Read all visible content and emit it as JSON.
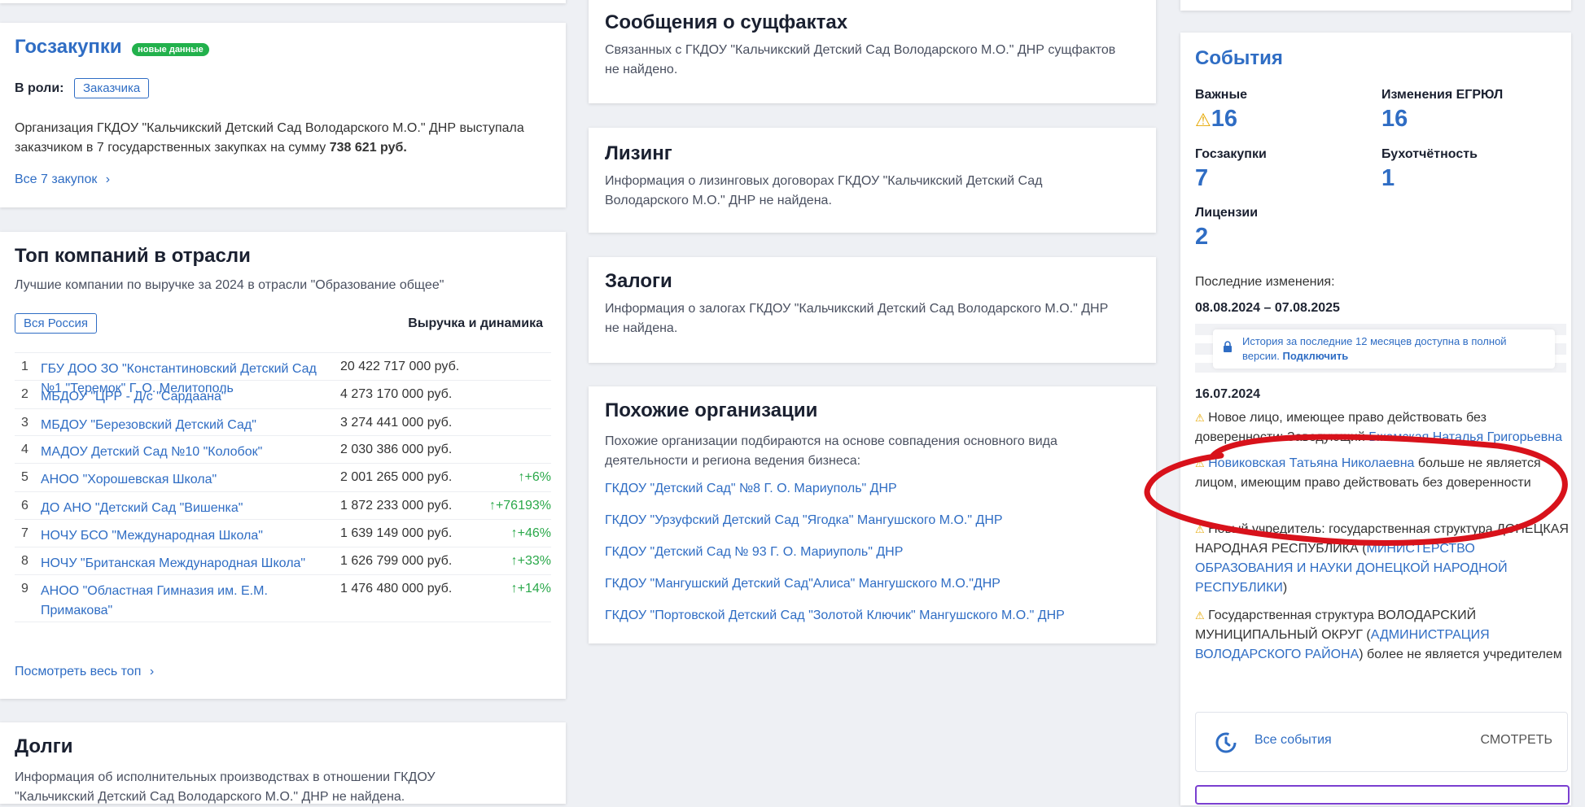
{
  "goszakupki": {
    "title": "Госзакупки",
    "badge": "новые данные",
    "role_label": "В роли:",
    "role_value": "Заказчика",
    "text": "Организация ГКДОУ \"Кальчикский Детский Сад Володарского М.О.\" ДНР выступала заказчиком в 7 государственных закупках на сумму",
    "amount": "738 621 руб.",
    "all_link": "Все 7 закупок"
  },
  "top": {
    "title": "Топ компаний в отрасли",
    "subtitle": "Лучшие компании по выручке за 2024 в отрасли \"Образование общее\"",
    "region_chip": "Вся Россия",
    "revenue_header": "Выручка и динамика",
    "rows": [
      {
        "n": "1",
        "name": "ГБУ ДОО ЗО \"Константиновский Детский Сад №1 \"Теремок\" Г. О. Мелитополь",
        "revenue": "20 422 717 000 руб.",
        "dyn": ""
      },
      {
        "n": "2",
        "name": "МБДОУ \"ЦРР - Д/с \"Сардаана\"",
        "revenue": "4 273 170 000 руб.",
        "dyn": ""
      },
      {
        "n": "3",
        "name": "МБДОУ \"Березовский Детский Сад\"",
        "revenue": "3 274 441 000 руб.",
        "dyn": ""
      },
      {
        "n": "4",
        "name": "МАДОУ Детский Сад №10 \"Колобок\"",
        "revenue": "2 030 386 000 руб.",
        "dyn": ""
      },
      {
        "n": "5",
        "name": "АНОО \"Хорошевская Школа\"",
        "revenue": "2 001 265 000 руб.",
        "dyn": "↑+6%"
      },
      {
        "n": "6",
        "name": "ДО АНО \"Детский Сад \"Вишенка\"",
        "revenue": "1 872 233 000 руб.",
        "dyn": "↑+76193%"
      },
      {
        "n": "7",
        "name": "НОЧУ БСО \"Международная Школа\"",
        "revenue": "1 639 149 000 руб.",
        "dyn": "↑+46%"
      },
      {
        "n": "8",
        "name": "НОЧУ \"Британская Международная Школа\"",
        "revenue": "1 626 799 000 руб.",
        "dyn": "↑+33%"
      },
      {
        "n": "9",
        "name": "АНОО \"Областная Гимназия им. Е.М. Примакова\"",
        "revenue": "1 476 480 000 руб.",
        "dyn": "↑+14%"
      }
    ],
    "all_link": "Посмотреть весь топ"
  },
  "dolgi": {
    "title": "Долги",
    "text": "Информация об исполнительных производствах в отношении ГКДОУ",
    "text2": "\"Кальчикский Детский Сад Володарского М.О.\" ДНР не найдена."
  },
  "sushfakty": {
    "title": "Сообщения о сущфактах",
    "text": "Связанных с ГКДОУ \"Кальчикский Детский Сад Володарского М.О.\" ДНР сущфактов не найдено."
  },
  "lizing": {
    "title": "Лизинг",
    "text": "Информация о лизинговых договорах ГКДОУ \"Кальчикский Детский Сад Володарского М.О.\" ДНР не найдена."
  },
  "zalogi": {
    "title": "Залоги",
    "text": "Информация о залогах ГКДОУ \"Кальчикский Детский Сад Володарского М.О.\" ДНР не найдена."
  },
  "similar": {
    "title": "Похожие организации",
    "text": "Похожие организации подбираются на основе совпадения основного вида деятельности и региона ведения бизнеса:",
    "links": [
      "ГКДОУ \"Детский Сад\" №8 Г. О. Мариуполь\" ДНР",
      "ГКДОУ \"Урзуфский Детский Сад \"Ягодка\" Мангушского М.О.\" ДНР",
      "ГКДОУ \"Детский Сад № 93 Г. О. Мариуполь\" ДНР",
      "ГКДОУ \"Мангушский Детский Сад\"Алиса\" Мангушского М.О.\"ДНР",
      "ГКДОУ \"Портовской Детский Сад \"Золотой Ключик\" Мангушского М.О.\" ДНР"
    ]
  },
  "events": {
    "title": "События",
    "stats": [
      {
        "label": "Важные",
        "value": "16",
        "warn": true
      },
      {
        "label": "Изменения ЕГРЮЛ",
        "value": "16",
        "warn": false
      },
      {
        "label": "Госзакупки",
        "value": "7",
        "warn": false
      },
      {
        "label": "Бухотчётность",
        "value": "1",
        "warn": false
      },
      {
        "label": "Лицензии",
        "value": "2",
        "warn": false
      }
    ],
    "last_changes_label": "Последние изменения:",
    "period": "08.08.2024 – 07.08.2025",
    "history_text": "История за последние 12 месяцев доступна в полной версии.",
    "history_link": "Подключить",
    "date": "16.07.2024",
    "items": [
      {
        "prefix": "Новое лицо, имеющее право действовать без доверенности: Заведующий ",
        "link": "Бжемская Наталья Григорьевна",
        "suffix": ""
      },
      {
        "prefix": "",
        "link": "Новиковская Татьяна Николаевна",
        "suffix": " больше не является лицом, имеющим право действовать без доверенности"
      },
      {
        "prefix": "Новый учредитель: государственная структура ДОНЕЦКАЯ НАРОДНАЯ РЕСПУБЛИКА (",
        "link": "МИНИСТЕРСТВО ОБРАЗОВАНИЯ И НАУКИ ДОНЕЦКОЙ НАРОДНОЙ РЕСПУБЛИКИ",
        "suffix": ")"
      },
      {
        "prefix": "Государственная структура ВОЛОДАРСКИЙ МУНИЦИПАЛЬНЫЙ ОКРУГ (",
        "link": "АДМИНИСТРАЦИЯ ВОЛОДАРСКОГО РАЙОНА",
        "suffix": ") более не является учредителем"
      }
    ],
    "all_events": "Все события",
    "view": "СМОТРЕТЬ"
  },
  "colors": {
    "accent": "#2f6dc4",
    "green": "#22b14c",
    "warn": "#e6a700",
    "annotation": "#d8121b"
  }
}
